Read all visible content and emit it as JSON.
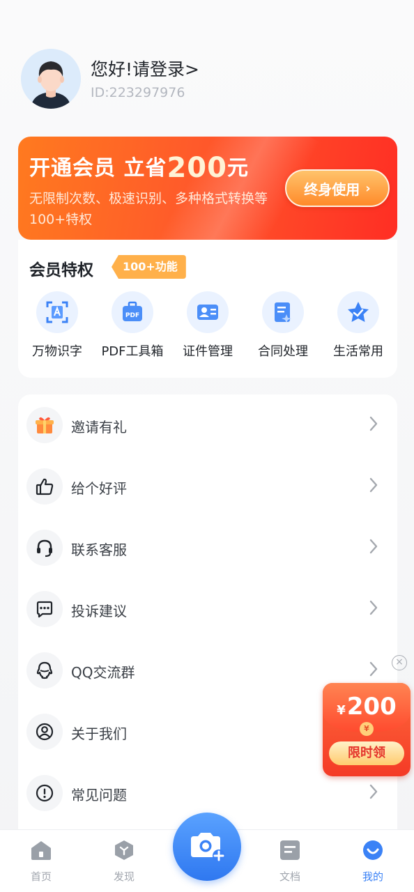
{
  "profile": {
    "greeting": "您好!请登录>",
    "user_id": "ID:223297976"
  },
  "vip_banner": {
    "title_prefix": "开通会员 立省",
    "amount": "200",
    "unit": "元",
    "description": "无限制次数、极速识别、多种格式转换等100+特权",
    "button_label": "终身使用",
    "button_chevron": "›"
  },
  "privileges": {
    "title": "会员特权",
    "badge": "100+功能",
    "items": [
      {
        "label": "万物识字",
        "icon": "text-scan-icon"
      },
      {
        "label": "PDF工具箱",
        "icon": "pdf-toolbox-icon"
      },
      {
        "label": "证件管理",
        "icon": "id-card-icon"
      },
      {
        "label": "合同处理",
        "icon": "contract-icon"
      },
      {
        "label": "生活常用",
        "icon": "star-icon"
      }
    ]
  },
  "menu": {
    "items": [
      {
        "label": "邀请有礼",
        "icon": "gift-icon"
      },
      {
        "label": "给个好评",
        "icon": "thumbs-up-icon"
      },
      {
        "label": "联系客服",
        "icon": "headset-icon"
      },
      {
        "label": "投诉建议",
        "icon": "feedback-icon"
      },
      {
        "label": "QQ交流群",
        "icon": "qq-icon"
      },
      {
        "label": "关于我们",
        "icon": "about-icon"
      },
      {
        "label": "常见问题",
        "icon": "question-icon"
      }
    ]
  },
  "red_packet": {
    "currency": "¥",
    "amount": "200",
    "coin": "¥",
    "button_label": "限时领",
    "close": "×"
  },
  "tabbar": {
    "items": [
      {
        "label": "首页",
        "icon": "home-icon"
      },
      {
        "label": "发现",
        "icon": "discover-icon"
      },
      {
        "label": "文档",
        "icon": "document-icon"
      },
      {
        "label": "我的",
        "icon": "profile-icon",
        "active": true
      }
    ],
    "camera_icon": "camera-add-icon"
  },
  "colors": {
    "accent": "#3b82f6",
    "vip_gradient_start": "#ff7a1f",
    "vip_gradient_end": "#ff2e24",
    "badge": "#ffb04a"
  }
}
